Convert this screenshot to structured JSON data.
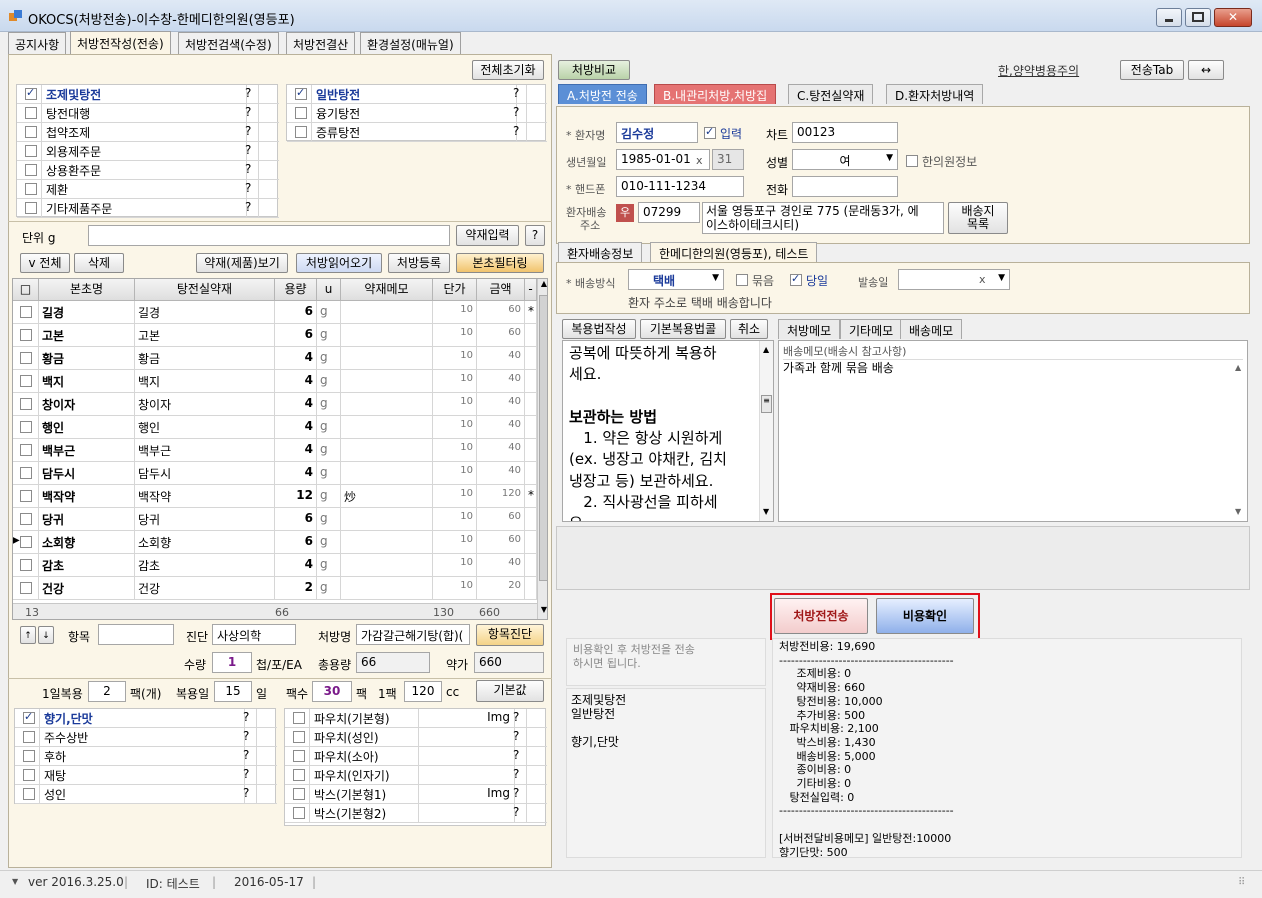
{
  "window": {
    "title": "OKOCS(처방전송)-이수창-한메디한의원(영등포)"
  },
  "main_tabs": [
    "공지사항",
    "처방전작성(전송)",
    "처방전검색(수정)",
    "처방전결산",
    "환경설정(매뉴얼)"
  ],
  "left": {
    "reset_button": "전체초기화",
    "checklist_a": [
      {
        "label": "조제및탕전",
        "checked": true,
        "q": "?"
      },
      {
        "label": "탕전대행",
        "checked": false,
        "q": "?"
      },
      {
        "label": "첩약조제",
        "checked": false,
        "q": "?"
      },
      {
        "label": "외용제주문",
        "checked": false,
        "q": "?"
      },
      {
        "label": "상용환주문",
        "checked": false,
        "q": "?"
      },
      {
        "label": "제환",
        "checked": false,
        "q": "?"
      },
      {
        "label": "기타제품주문",
        "checked": false,
        "q": "?"
      }
    ],
    "checklist_b": [
      {
        "label": "일반탕전",
        "checked": true,
        "q": "?"
      },
      {
        "label": "융기탕전",
        "checked": false,
        "q": "?"
      },
      {
        "label": "증류탕전",
        "checked": false,
        "q": "?"
      }
    ],
    "unit_label": "단위 g",
    "herb_input_button": "약재입력",
    "help_button": "?",
    "all_button": "v 전체",
    "delete_button": "삭제",
    "view_button": "약재(제품)보기",
    "load_button": "처방읽어오기",
    "register_button": "처방등록",
    "filter_button": "본초필터링",
    "grid_headers": [
      "□",
      "본초명",
      "탕전실약재",
      "용량",
      "u",
      "약재메모",
      "단가",
      "금액",
      "-"
    ],
    "rows": [
      {
        "name": "길경",
        "herb": "길경",
        "qty": "6",
        "u": "g",
        "memo": "",
        "price": "10",
        "amount": "60",
        "mark": "*"
      },
      {
        "name": "고본",
        "herb": "고본",
        "qty": "6",
        "u": "g",
        "memo": "",
        "price": "10",
        "amount": "60",
        "mark": ""
      },
      {
        "name": "황금",
        "herb": "황금",
        "qty": "4",
        "u": "g",
        "memo": "",
        "price": "10",
        "amount": "40",
        "mark": ""
      },
      {
        "name": "백지",
        "herb": "백지",
        "qty": "4",
        "u": "g",
        "memo": "",
        "price": "10",
        "amount": "40",
        "mark": ""
      },
      {
        "name": "창이자",
        "herb": "창이자",
        "qty": "4",
        "u": "g",
        "memo": "",
        "price": "10",
        "amount": "40",
        "mark": ""
      },
      {
        "name": "행인",
        "herb": "행인",
        "qty": "4",
        "u": "g",
        "memo": "",
        "price": "10",
        "amount": "40",
        "mark": ""
      },
      {
        "name": "백부근",
        "herb": "백부근",
        "qty": "4",
        "u": "g",
        "memo": "",
        "price": "10",
        "amount": "40",
        "mark": ""
      },
      {
        "name": "담두시",
        "herb": "담두시",
        "qty": "4",
        "u": "g",
        "memo": "",
        "price": "10",
        "amount": "40",
        "mark": ""
      },
      {
        "name": "백작약",
        "herb": "백작약",
        "qty": "12",
        "u": "g",
        "memo": "炒",
        "price": "10",
        "amount": "120",
        "mark": "*"
      },
      {
        "name": "당귀",
        "herb": "당귀",
        "qty": "6",
        "u": "g",
        "memo": "",
        "price": "10",
        "amount": "60",
        "mark": ""
      },
      {
        "name": "소회향",
        "herb": "소회향",
        "qty": "6",
        "u": "g",
        "memo": "",
        "price": "10",
        "amount": "60",
        "mark": ""
      },
      {
        "name": "감초",
        "herb": "감초",
        "qty": "4",
        "u": "g",
        "memo": "",
        "price": "10",
        "amount": "40",
        "mark": ""
      },
      {
        "name": "건강",
        "herb": "건강",
        "qty": "2",
        "u": "g",
        "memo": "",
        "price": "10",
        "amount": "20",
        "mark": ""
      }
    ],
    "footer": {
      "count": "13",
      "qty_sum": "66",
      "price_sum": "130",
      "amount_sum": "660"
    },
    "item_label": "항목",
    "diagnosis_label": "진단",
    "diagnosis_value": "사상의학",
    "rx_name_label": "처방명",
    "rx_name_value": "가감갈근해기탕(합)(",
    "item_diag_button": "항목진단",
    "quantity_label": "수량",
    "quantity_value": "1",
    "quantity_unit": "첩/포/EA",
    "total_label": "총용량",
    "total_value": "66",
    "cost_label": "약가",
    "cost_value": "660",
    "daily_label": "1일복용",
    "daily_value": "2",
    "daily_unit": "팩(개)",
    "days_label": "복용일",
    "days_value": "15",
    "days_unit": "일",
    "packs_label": "팩수",
    "packs_value": "30",
    "packs_unit": "팩",
    "per_pack_label": "1팩",
    "per_pack_value": "120",
    "per_pack_unit": "cc",
    "default_button": "기본값",
    "flavor_list": [
      {
        "label": "향기,단맛",
        "checked": true,
        "q": "?"
      },
      {
        "label": "주수상반",
        "checked": false,
        "q": "?"
      },
      {
        "label": "후하",
        "checked": false,
        "q": "?"
      },
      {
        "label": "재탕",
        "checked": false,
        "q": "?"
      },
      {
        "label": "성인",
        "checked": false,
        "q": "?"
      }
    ],
    "pack_list": [
      {
        "label": "파우치(기본형)",
        "img": "Img",
        "checked": false,
        "q": "?"
      },
      {
        "label": "파우치(성인)",
        "img": "",
        "checked": false,
        "q": "?"
      },
      {
        "label": "파우치(소아)",
        "img": "",
        "checked": false,
        "q": "?"
      },
      {
        "label": "파우치(인자기)",
        "img": "",
        "checked": false,
        "q": "?"
      },
      {
        "label": "박스(기본형1)",
        "img": "Img",
        "checked": false,
        "q": "?"
      },
      {
        "label": "박스(기본형2)",
        "img": "",
        "checked": false,
        "q": "?"
      }
    ]
  },
  "right": {
    "compare_button": "처방비교",
    "caution_link": "한,양약병용주의",
    "send_tab_button": "전송Tab",
    "arrow_button": "↔",
    "tabs": [
      "A.처방전 전송",
      "B.내관리처방,처방집",
      "C.탕전실약재",
      "D.환자처방내역"
    ],
    "patient_label": "* 환자명",
    "patient_value": "김수정",
    "input_label": "입력",
    "chart_label": "차트",
    "chart_value": "00123",
    "birth_label": "생년월일",
    "birth_value": "1985-01-01",
    "birth_x": "x",
    "age_value": "31",
    "sex_label": "성별",
    "sex_value": "여",
    "clinic_info_label": "한의원정보",
    "phone_label": "* 핸드폰",
    "phone_value": "010-111-1234",
    "tel_label": "전화",
    "tel_value": "",
    "addr_label1": "환자배송",
    "addr_label2": "주소",
    "addr_badge": "우",
    "zip_value": "07299",
    "addr_value1": "서울 영등포구 경인로 775 (문래동3가, 에",
    "addr_value2": "이스하이테크시티)",
    "addr_list_button1": "배송지",
    "addr_list_button2": "목록",
    "ship_tabs": [
      "환자배송정보",
      "한메디한의원(영등포), 테스트"
    ],
    "ship_method_label": "* 배송방식",
    "ship_method_value": "택배",
    "bundle_label": "묶음",
    "sameday_label": "당일",
    "ship_date_label": "발송일",
    "ship_date_x": "x",
    "ship_note": "환자 주소로 택배 배송합니다",
    "method_button": "복용법작성",
    "basic_method_button": "기본복용법콜",
    "cancel_button": "취소",
    "memo_tabs": [
      "처방메모",
      "기타메모",
      "배송메모"
    ],
    "instructions": [
      "공복에 따뜻하게 복용하",
      "세요.",
      "",
      "보관하는 방법",
      "   1. 약은 항상 시원하게",
      "(ex. 냉장고 야채칸, 김치",
      "냉장고 등) 보관하세요.",
      "   2. 직사광선을 피하세",
      "요."
    ],
    "memo_header": "배송메모(배송시 참고사항)",
    "memo_text": "가족과 함께 묶음 배송",
    "send_rx_button": "처방전전송",
    "cost_check_button": "비용확인",
    "cost_hint1": "비용확인 후 처방전을 전송",
    "cost_hint2": "하시면 됩니다.",
    "summary_lines": [
      "조제및탕전",
      "일반탕전",
      "",
      "향기,단맛"
    ],
    "cost_lines": [
      "처방전비용: 19,690",
      "--------------------------------------------",
      "     조제비용: 0",
      "     약재비용: 660",
      "     탕전비용: 10,000",
      "     추가비용: 500",
      "   파우치비용: 2,100",
      "     박스비용: 1,430",
      "     배송비용: 5,000",
      "     종이비용: 0",
      "     기타비용: 0",
      "   탕전실입력: 0",
      "--------------------------------------------",
      "",
      "[서버전달비용메모] 일반탕전:10000",
      "향기단맛: 500"
    ]
  },
  "status": {
    "version": "ver 2016.3.25.0",
    "id": "ID: 테스트",
    "date": "2016-05-17"
  }
}
